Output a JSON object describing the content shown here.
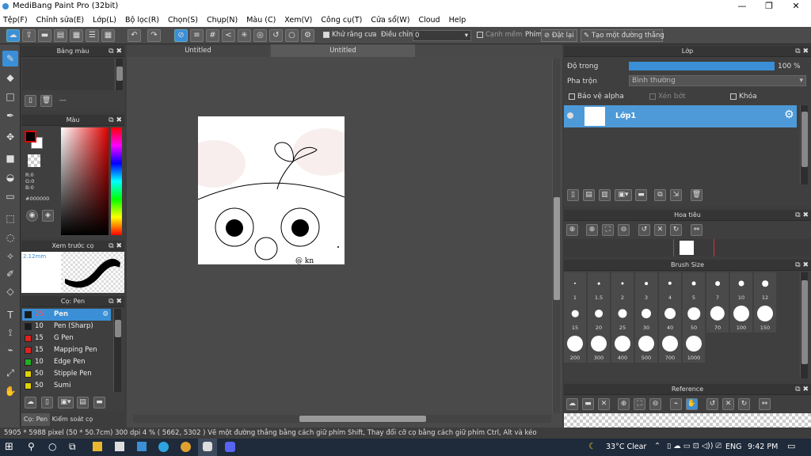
{
  "window": {
    "title": "MediBang Paint Pro (32bit)",
    "minimize": "—",
    "maximize": "❐",
    "close": "✕"
  },
  "menu": [
    "Tệp(F)",
    "Chỉnh sửa(E)",
    "Lớp(L)",
    "Bộ lọc(R)",
    "Chọn(S)",
    "Chụp(N)",
    "Màu (C)",
    "Xem(V)",
    "Công cụ(T)",
    "Cửa sổ(W)",
    "Cloud",
    "Help"
  ],
  "toolbar": {
    "antialias": "Khử răng cưa",
    "adjust_label": "Điều chỉnh",
    "adjust_value": "0",
    "soft_edge": "Cạnh mềm",
    "key_label": "Phím",
    "reset": "Đặt lại",
    "straight_line": "Tạo một đường thẳng"
  },
  "palette": {
    "title": "Bảng màu",
    "row_text": "---"
  },
  "color": {
    "title": "Màu",
    "r": "R:0",
    "g": "G:0",
    "b": "B:0",
    "hex": "#000000"
  },
  "preview": {
    "title": "Xem trước cọ",
    "size": "2.12mm"
  },
  "brush": {
    "title": "Cọ: Pen",
    "items": [
      {
        "size": "25",
        "name": "Pen",
        "color": "#1a1a1a"
      },
      {
        "size": "10",
        "name": "Pen (Sharp)",
        "color": "#1a1a1a"
      },
      {
        "size": "15",
        "name": "G Pen",
        "color": "#e02020"
      },
      {
        "size": "15",
        "name": "Mapping Pen",
        "color": "#e02020"
      },
      {
        "size": "10",
        "name": "Edge Pen",
        "color": "#20b020"
      },
      {
        "size": "50",
        "name": "Stipple Pen",
        "color": "#e0d000"
      },
      {
        "size": "50",
        "name": "Sumi",
        "color": "#e0d000"
      }
    ]
  },
  "bottom_tabs": [
    "Cọ: Pen",
    "Kiểm soát cọ"
  ],
  "canvas": {
    "tabs": [
      "Untitled",
      "Untitled"
    ],
    "signature": "@ kn"
  },
  "layer": {
    "title": "Lớp",
    "opacity_label": "Độ trong",
    "opacity_value": "100 %",
    "opacity_fraction": 1.0,
    "blend_label": "Pha trộn",
    "blend_value": "Bình thường",
    "protect_alpha": "Bảo vệ alpha",
    "clipping": "Xén bớt",
    "lock": "Khóa",
    "layer_name": "Lớp1"
  },
  "navigator": {
    "title": "Hoa tiêu"
  },
  "brushsize": {
    "title": "Brush Size",
    "sizes": [
      "1",
      "1.5",
      "2",
      "3",
      "4",
      "5",
      "7",
      "10",
      "12",
      "15",
      "20",
      "25",
      "30",
      "40",
      "50",
      "70",
      "100",
      "150",
      "200",
      "300",
      "400",
      "500",
      "700",
      "1000"
    ]
  },
  "reference": {
    "title": "Reference"
  },
  "status": "5905 * 5988 pixel  (50 * 50.7cm)  300 dpi  4 %  ( 5662, 5302 )  Vẽ một đường thẳng bằng cách giữ phím Shift, Thay đổi cỡ cọ bằng cách giữ phím Ctrl, Alt và kéo",
  "taskbar": {
    "weather": "33°C  Clear",
    "lang": "ENG",
    "time": "9:42 PM"
  }
}
